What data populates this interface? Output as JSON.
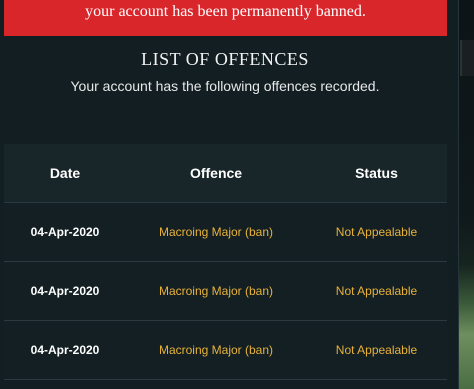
{
  "banner": {
    "text": "your account has been permanently banned.",
    "color": "#d9262b"
  },
  "header": {
    "title": "LIST OF OFFENCES",
    "subtitle": "Your account has the following offences recorded."
  },
  "table": {
    "columns": [
      "Date",
      "Offence",
      "Status"
    ],
    "rows": [
      {
        "date": "04-Apr-2020",
        "offence": "Macroing Major (ban)",
        "status": "Not Appealable"
      },
      {
        "date": "04-Apr-2020",
        "offence": "Macroing Major (ban)",
        "status": "Not Appealable"
      },
      {
        "date": "04-Apr-2020",
        "offence": "Macroing Major (ban)",
        "status": "Not Appealable"
      }
    ]
  },
  "colors": {
    "accent_text": "#e8b23a",
    "panel_bg": "#121e22"
  }
}
